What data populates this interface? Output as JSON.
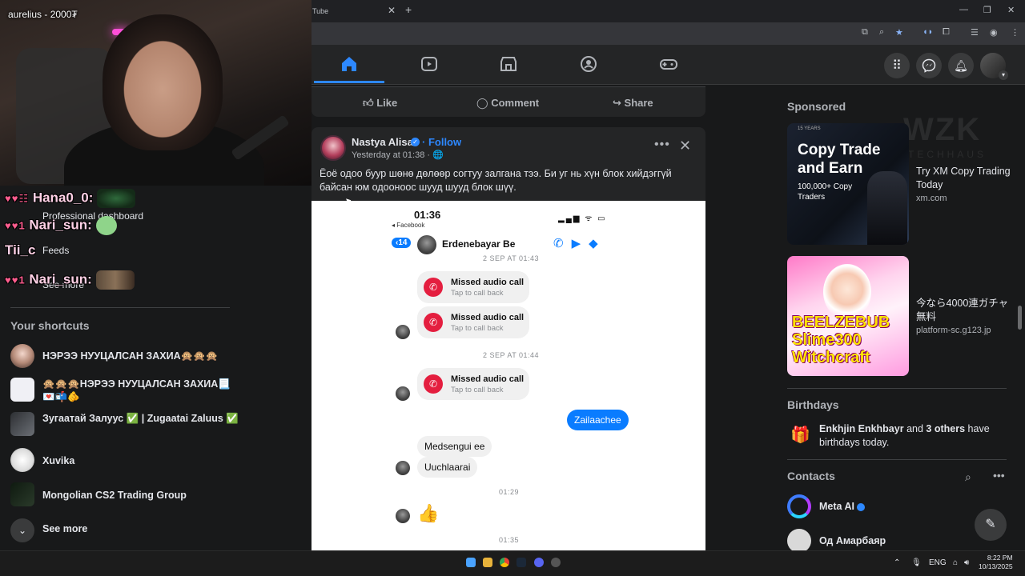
{
  "browser": {
    "tab_title": "Tube",
    "tab_close": "✕",
    "new_tab": "+",
    "window_controls": [
      "—",
      "❐",
      "✕"
    ]
  },
  "stream": {
    "streamer_name": "aurelius - 2000₮",
    "chat": [
      {
        "badges": "♥♥☷",
        "name": "Hana0_0:"
      },
      {
        "badges": "♥♥1",
        "name": "Nari_sun:"
      },
      {
        "badges": "",
        "name": "Tii_c"
      },
      {
        "badges": "♥♥1",
        "name": "Nari_sun:"
      }
    ]
  },
  "sidebar": {
    "underlay": {
      "dashboard": "Professional dashboard",
      "feeds": "Feeds",
      "see_more": "See more"
    },
    "shortcuts_title": "Your shortcuts",
    "shortcuts": [
      {
        "label": "НЭРЭЭ НУУЦАЛСАН ЗАХИА🙊🙊🙊"
      },
      {
        "label": "🙊🙊🙊НЭРЭЭ НУУЦАЛСАН ЗАХИА📃💌📬🫵"
      },
      {
        "label": "Зугаатай Залуус ✅ | Zugaatai Zaluus ✅"
      },
      {
        "label": "Xuvika"
      },
      {
        "label": "Mongolian CS2 Trading Group"
      }
    ],
    "see_more": "See more"
  },
  "feed": {
    "actions": {
      "like": "Like",
      "comment": "Comment",
      "share": "Share"
    },
    "post": {
      "author": "Nastya Alisa",
      "follow": "Follow",
      "time": "Yesterday at 01:38 · 🌐",
      "text": "Ёоё одоо буур шөнө дөлөөр согтуу залгана тээ. Би уг нь хүн блок хийдэггүй байсан юм одооноос шууд шууд блок шүү.",
      "more": "•••",
      "close": "✕"
    },
    "screenshot": {
      "status_time": "01:36",
      "back_app": "◂ Facebook",
      "status_icons": "▂▄▆ ᯤ ▭",
      "back_count": "14",
      "contact": "Erdenebayar Be",
      "date1": "2 SEP AT 01:43",
      "date2": "2 SEP AT 01:44",
      "missed_label": "Missed audio call",
      "missed_sub": "Tap to call back",
      "out_msg": "Zailaachee",
      "in_msg1": "Medsengui ee",
      "in_msg2": "Uuchlaarai",
      "time1": "01:29",
      "time2": "01:35",
      "like": "👍"
    }
  },
  "right": {
    "sponsored": "Sponsored",
    "ads": [
      {
        "image_headline": "Copy Trade and Earn",
        "image_sub": "100,000+ Copy Traders",
        "image_mark": "15 YEARS",
        "title": "Try XM Copy Trading Today",
        "url": "xm.com"
      },
      {
        "image_text": "BEELZEBUB Slime300 Witchcraft",
        "title": "今なら4000連ガチャ無料",
        "url": "platform-sc.g123.jp"
      }
    ],
    "birthdays_title": "Birthdays",
    "birthday_name": "Enkhjin Enkhbayr",
    "birthday_and": "and",
    "birthday_others": "3 others",
    "birthday_rest": "have birthdays today.",
    "contacts_title": "Contacts",
    "contacts": [
      {
        "name": "Meta AI"
      },
      {
        "name": "Од Амарбаяр"
      }
    ],
    "watermark": "WZK",
    "watermark_sub": "TECHHAUS"
  },
  "taskbar": {
    "lang": "ENG",
    "time": "8:22 PM",
    "date": "10/13/2025"
  },
  "colors": {
    "accent": "#2d88ff",
    "messenger_blue": "#0a7cff",
    "missed_red": "#e41e3f",
    "background": "#18191a",
    "card": "#242526"
  }
}
